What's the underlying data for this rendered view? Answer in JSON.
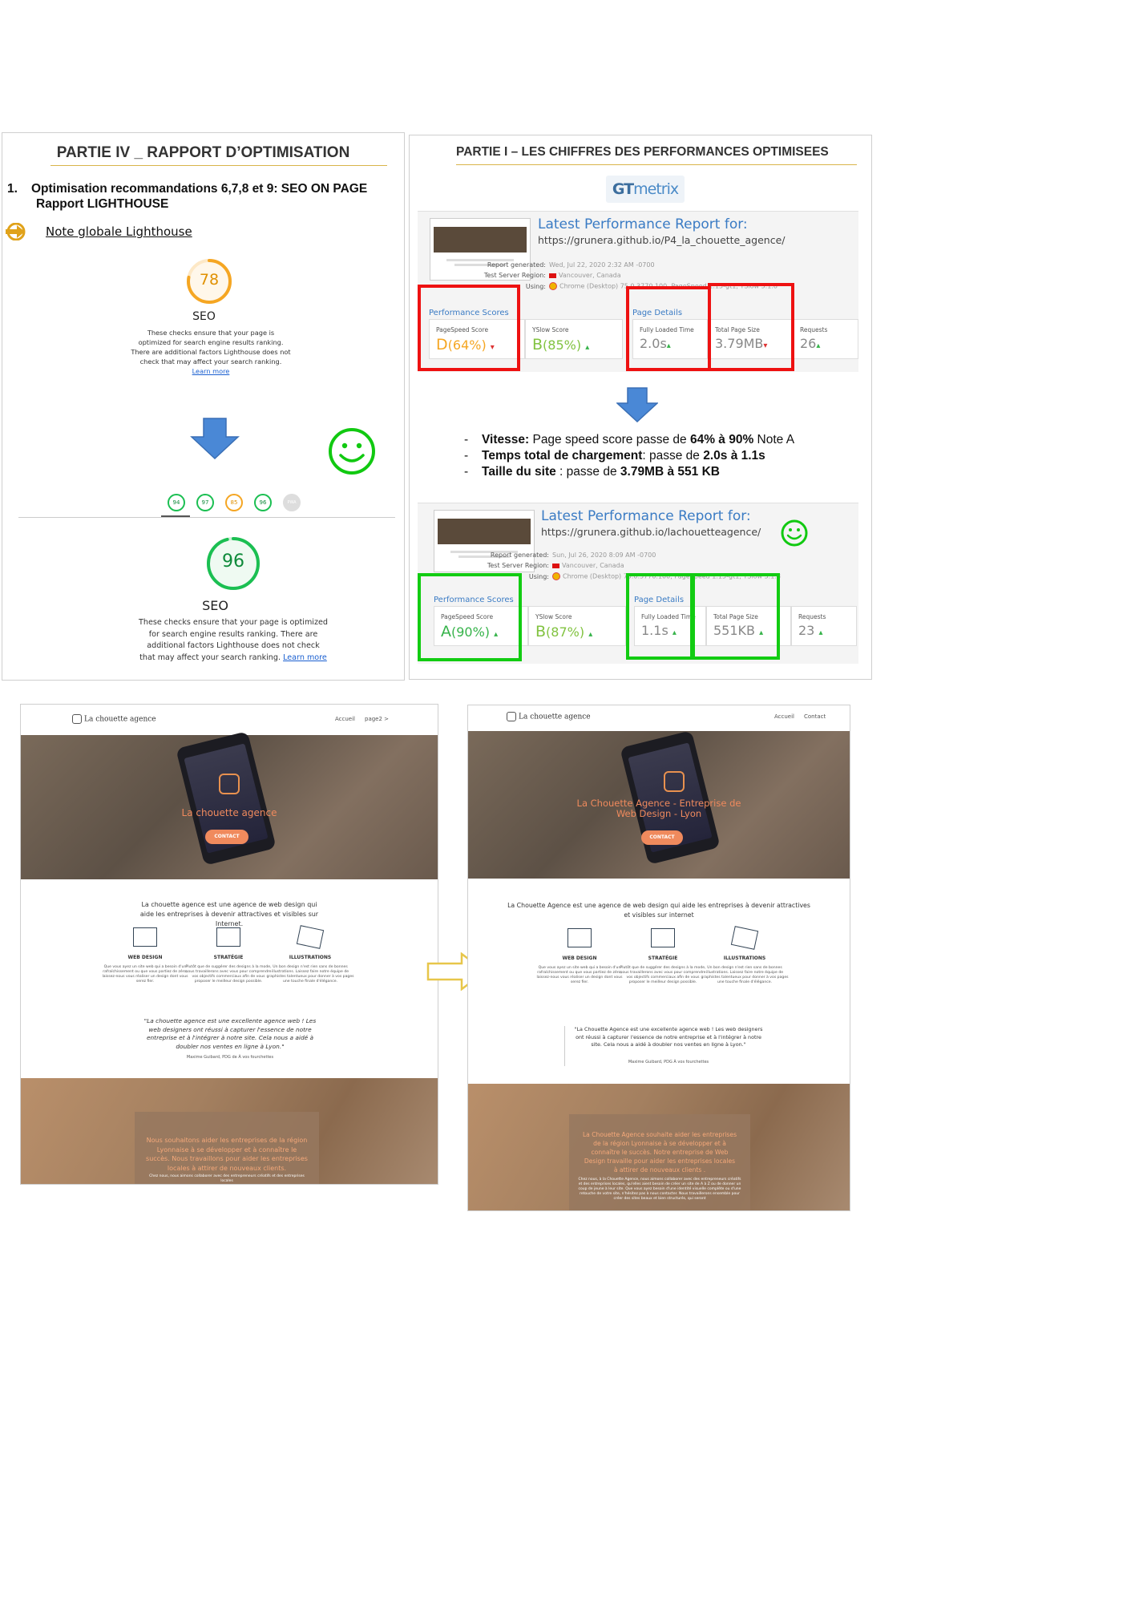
{
  "left_panel": {
    "title": "PARTIE IV _ RAPPORT D’OPTIMISATION",
    "heading_num": "1.",
    "heading_line1": "Optimisation recommandations 6,7,8 et 9: SEO ON PAGE",
    "heading_line2": "Rapport LIGHTHOUSE",
    "note": "Note globale  Lighthouse",
    "before": {
      "score": "78",
      "score_value": 78,
      "label": "SEO",
      "desc": "These checks ensure that your page is optimized for search engine results ranking. There are additional factors Lighthouse does not check that may affect your search ranking.",
      "link": "Learn more"
    },
    "mini_scores": [
      "94",
      "97",
      "85",
      "96",
      "PWA"
    ],
    "after": {
      "score": "96",
      "score_value": 96,
      "label": "SEO",
      "desc": "These checks ensure that your page is optimized for search engine results ranking. There are additional factors Lighthouse does not check that may affect your search ranking.",
      "link": "Learn more"
    },
    "colors": {
      "orange": "#f5a623",
      "green": "#1bbf52",
      "arrow": "#4a88d6"
    }
  },
  "right_panel": {
    "title": "PARTIE I – LES CHIFFRES DES PERFORMANCES OPTIMISEES",
    "logo_gt": "GT",
    "logo_metrix": "metrix",
    "reports": [
      {
        "title": "Latest Performance Report for:",
        "url": "https://grunera.github.io/P4_la_chouette_agence/",
        "generated_k": "Report generated:",
        "generated_v": "Wed, Jul 22, 2020 2:32 AM -0700",
        "region_k": "Test Server Region:",
        "region_v": "Vancouver, Canada",
        "using_k": "Using:",
        "using_v": "Chrome (Desktop) 75.0.3770.100, PageSpeed 1.15-gt1, YSlow 3.1.8",
        "perf_label": "Performance Scores",
        "details_label": "Page Details",
        "pagespeed_label": "PageSpeed Score",
        "pagespeed_grade": "D",
        "pagespeed_pct": "(64%)",
        "yslow_label": "YSlow Score",
        "yslow_grade": "B",
        "yslow_pct": "(85%)",
        "load_label": "Fully Loaded Time",
        "load_value": "2.0s",
        "size_label": "Total Page Size",
        "size_value": "3.79MB",
        "req_label": "Requests",
        "req_value": "26"
      },
      {
        "title": "Latest Performance Report for:",
        "url": "https://grunera.github.io/lachouetteagence/",
        "generated_k": "Report generated:",
        "generated_v": "Sun, Jul 26, 2020 8:09 AM -0700",
        "region_k": "Test Server Region:",
        "region_v": "Vancouver, Canada",
        "using_k": "Using:",
        "using_v": "Chrome (Desktop) 75.0.3770.100, PageSpeed 1.15-gt1, YSlow 3.1.8",
        "perf_label": "Performance Scores",
        "details_label": "Page Details",
        "pagespeed_label": "PageSpeed Score",
        "pagespeed_grade": "A",
        "pagespeed_pct": "(90%)",
        "yslow_label": "YSlow Score",
        "yslow_grade": "B",
        "yslow_pct": "(87%)",
        "load_label": "Fully Loaded Time",
        "load_value": "1.1s",
        "size_label": "Total Page Size",
        "size_value": "551KB",
        "req_label": "Requests",
        "req_value": "23"
      }
    ],
    "bullets": [
      {
        "b1": "Vitesse:",
        "t1": " Page speed score passe de ",
        "b2": "64% à 90%",
        "t2": "  Note A"
      },
      {
        "b1": "Temps total de chargement",
        "t1": ": passe de ",
        "b2": "2.0s à 1.1s",
        "t2": ""
      },
      {
        "b1": "Taille du site",
        "t1": " : passe de ",
        "b2": "3.79MB à 551 KB",
        "t2": ""
      }
    ]
  },
  "site_before": {
    "logo": "La chouette agence",
    "menu": [
      "Accueil",
      "page2 >"
    ],
    "hero_title": "La chouette agence",
    "cta": "CONTACT",
    "intro": "La chouette agence est une agence de web design qui aide les entreprises à devenir attractives et visibles sur Internet.",
    "services": [
      {
        "name": "WEB DESIGN",
        "text": "Que vous ayez un site web qui a besoin d'un rafraîchissement ou que vous partiez de zéro, laissez-nous vous réaliser un design dont vous serez fier."
      },
      {
        "name": "STRATÉGIE",
        "text": "Plutôt que de suggérer des designs à la mode, nous travaillerons avec vous pour comprendre vos objectifs commerciaux afin de vous proposer le meilleur design possible."
      },
      {
        "name": "ILLUSTRATIONS",
        "text": "Un bon design n'est rien sans de bonnes illustrations. Laissez faire notre équipe de graphistes talentueux pour donner à vos pages une touche finale d'élégance."
      }
    ],
    "quote": "\"La chouette agence est une excellente agence web ! Les web designers ont réussi à capturer l'essence de notre entreprise et à l'intégrer à notre site. Cela nous a aidé à doubler nos ventes en ligne à Lyon.\"",
    "quote_sig": "Maxime Guibard, PDG de À vos fourchettes",
    "bottom_text": "Nous souhaitons aider les entreprises de la région Lyonnaise à se développer et à connaître le succès. Nous travaillons pour aider les entreprises locales à attirer de nouveaux clients.",
    "bottom_small": "Chez nous, nous aimons collaborer avec des entrepreneurs créatifs et des entreprises locales"
  },
  "site_after": {
    "logo": "La chouette agence",
    "menu": [
      "Accueil",
      "Contact"
    ],
    "hero_title": "La Chouette Agence - Entreprise de Web Design - Lyon",
    "cta": "CONTACT",
    "intro": "La Chouette Agence est une agence de web design qui aide les entreprises à devenir attractives et visibles sur internet",
    "services": [
      {
        "name": "WEB DESIGN",
        "text": "Que vous ayez un site web qui a besoin d'un rafraîchissement ou que vous partiez de zéro, laissez-nous vous réaliser un design dont vous serez fier."
      },
      {
        "name": "STRATÉGIE",
        "text": "Plutôt que de suggérer des designs à la mode, nous travaillerons avec vous pour comprendre vos objectifs commerciaux afin de vous proposer le meilleur design possible."
      },
      {
        "name": "ILLUSTRATIONS",
        "text": "Un bon design n'est rien sans de bonnes illustrations. Laissez faire notre équipe de graphistes talentueux pour donner à vos pages une touche finale d'élégance."
      }
    ],
    "quote": "\"La Chouette Agence est une excellente agence web ! Les web designers ont réussi à capturer l'essence de notre entreprise et à l'intégrer à notre site. Cela nous a aidé à doubler nos ventes en ligne à Lyon.\"",
    "quote_sig": "Maxime Guibard, PDG À vos fourchettes",
    "bottom_text": "La Chouette Agence souhaite aider les entreprises de la région Lyonnaise à se développer et à connaître le succès. Notre entreprise de Web Design travaille pour aider les entreprises locales à attirer de nouveaux clients .",
    "bottom_small": "Chez nous, à la Chouette Agence, nous aimons collaborer avec des entrepreneurs créatifs et des entreprises locales, qu'elles aient besoin de créer un site de A à Z ou de donner un coup de jeune à leur site. Que vous ayez besoin d'une identité visuelle complète ou d'une retouche de votre site, n'hésitez pas à nous contacter. Nous travaillerons ensemble pour créer des sites beaux et bien structurés, qui seront"
  }
}
